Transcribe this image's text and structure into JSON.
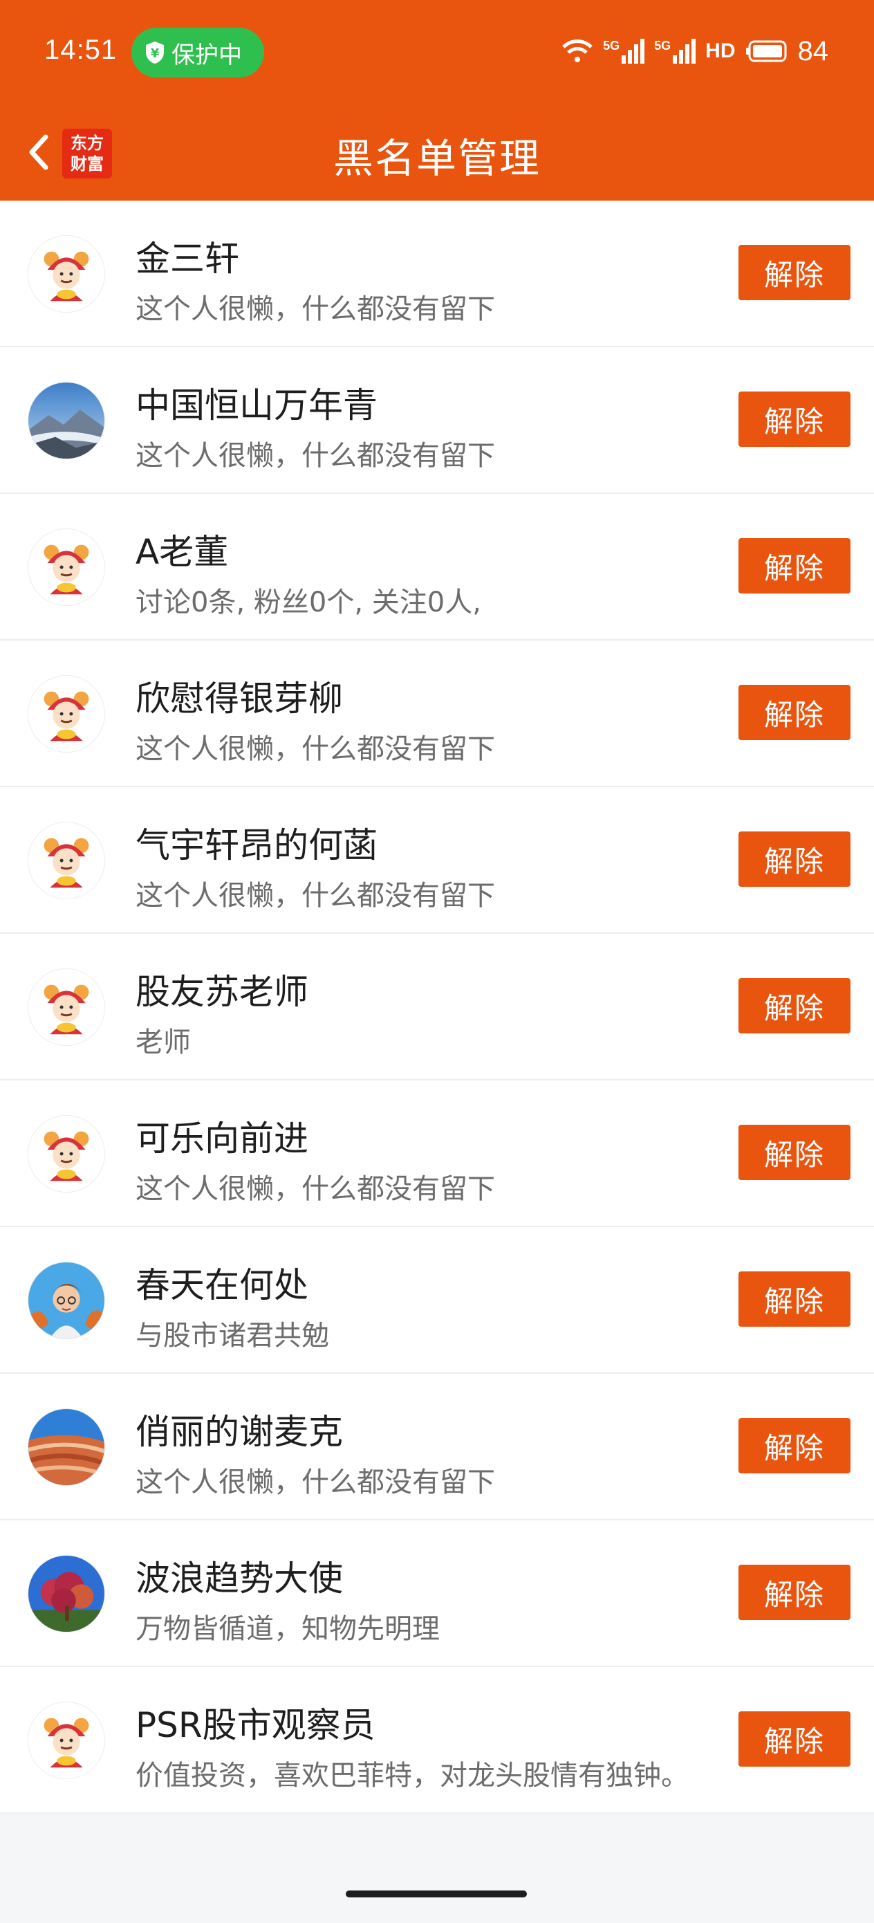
{
  "status_bar": {
    "time": "14:51",
    "protect_label": "保护中",
    "network_5g_1": "5G",
    "network_5g_2": "5G",
    "hd_label": "HD",
    "battery_level": "84"
  },
  "header": {
    "logo_line1": "东方",
    "logo_line2": "财富",
    "title": "黑名单管理"
  },
  "colors": {
    "brand_orange": "#e9550e",
    "protect_green": "#2fbf4f"
  },
  "blocked_users": [
    {
      "name": "金三轩",
      "desc": "这个人很懒，什么都没有留下",
      "avatar": "mascot",
      "action": "解除"
    },
    {
      "name": "中国恒山万年青",
      "desc": "这个人很懒，什么都没有留下",
      "avatar": "mountain",
      "action": "解除"
    },
    {
      "name": "A老董",
      "desc": "讨论0条, 粉丝0个, 关注0人,",
      "avatar": "mascot",
      "action": "解除"
    },
    {
      "name": "欣慰得银芽柳",
      "desc": "这个人很懒，什么都没有留下",
      "avatar": "mascot",
      "action": "解除"
    },
    {
      "name": "气宇轩昂的何菡",
      "desc": "这个人很懒，什么都没有留下",
      "avatar": "mascot",
      "action": "解除"
    },
    {
      "name": "股友苏老师",
      "desc": "老师",
      "avatar": "mascot",
      "action": "解除"
    },
    {
      "name": "可乐向前进",
      "desc": "这个人很懒，什么都没有留下",
      "avatar": "mascot",
      "action": "解除"
    },
    {
      "name": "春天在何处",
      "desc": "与股市诸君共勉",
      "avatar": "cartoon-boy",
      "action": "解除"
    },
    {
      "name": "俏丽的谢麦克",
      "desc": "这个人很懒，什么都没有留下",
      "avatar": "red-rock",
      "action": "解除"
    },
    {
      "name": "波浪趋势大使",
      "desc": "万物皆循道，知物先明理",
      "avatar": "autumn-tree",
      "action": "解除"
    },
    {
      "name": "PSR股市观察员",
      "desc": "价值投资，喜欢巴菲特，对龙头股情有独钟。",
      "avatar": "mascot",
      "action": "解除"
    }
  ]
}
